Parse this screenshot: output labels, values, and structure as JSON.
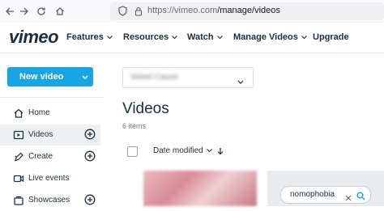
{
  "browser": {
    "url_domain": "https://vimeo.com",
    "url_path": "/manage/videos",
    "icons": [
      "back-icon",
      "forward-icon",
      "reload-icon",
      "home-icon",
      "shield-icon",
      "lock-icon"
    ]
  },
  "header": {
    "logo": "vimeo",
    "nav": [
      {
        "label": "Features"
      },
      {
        "label": "Resources"
      },
      {
        "label": "Watch"
      },
      {
        "label": "Manage Videos"
      },
      {
        "label": "Upgrade"
      }
    ]
  },
  "sidebar": {
    "new_video": "New video",
    "items": [
      {
        "label": "Home",
        "icon": "home-icon"
      },
      {
        "label": "Videos",
        "icon": "video-icon"
      },
      {
        "label": "Create",
        "icon": "create-icon"
      },
      {
        "label": "Live events",
        "icon": "live-events-icon"
      },
      {
        "label": "Showcases",
        "icon": "showcases-icon"
      }
    ]
  },
  "main": {
    "team_select": "Velvet Cause",
    "title": "Videos",
    "count": "6 items",
    "sort_label": "Date modified",
    "search_value": "nomophobia"
  },
  "colors": {
    "accent": "#17a5e6",
    "text": "#1a2e3b",
    "muted": "#6f7b84"
  }
}
